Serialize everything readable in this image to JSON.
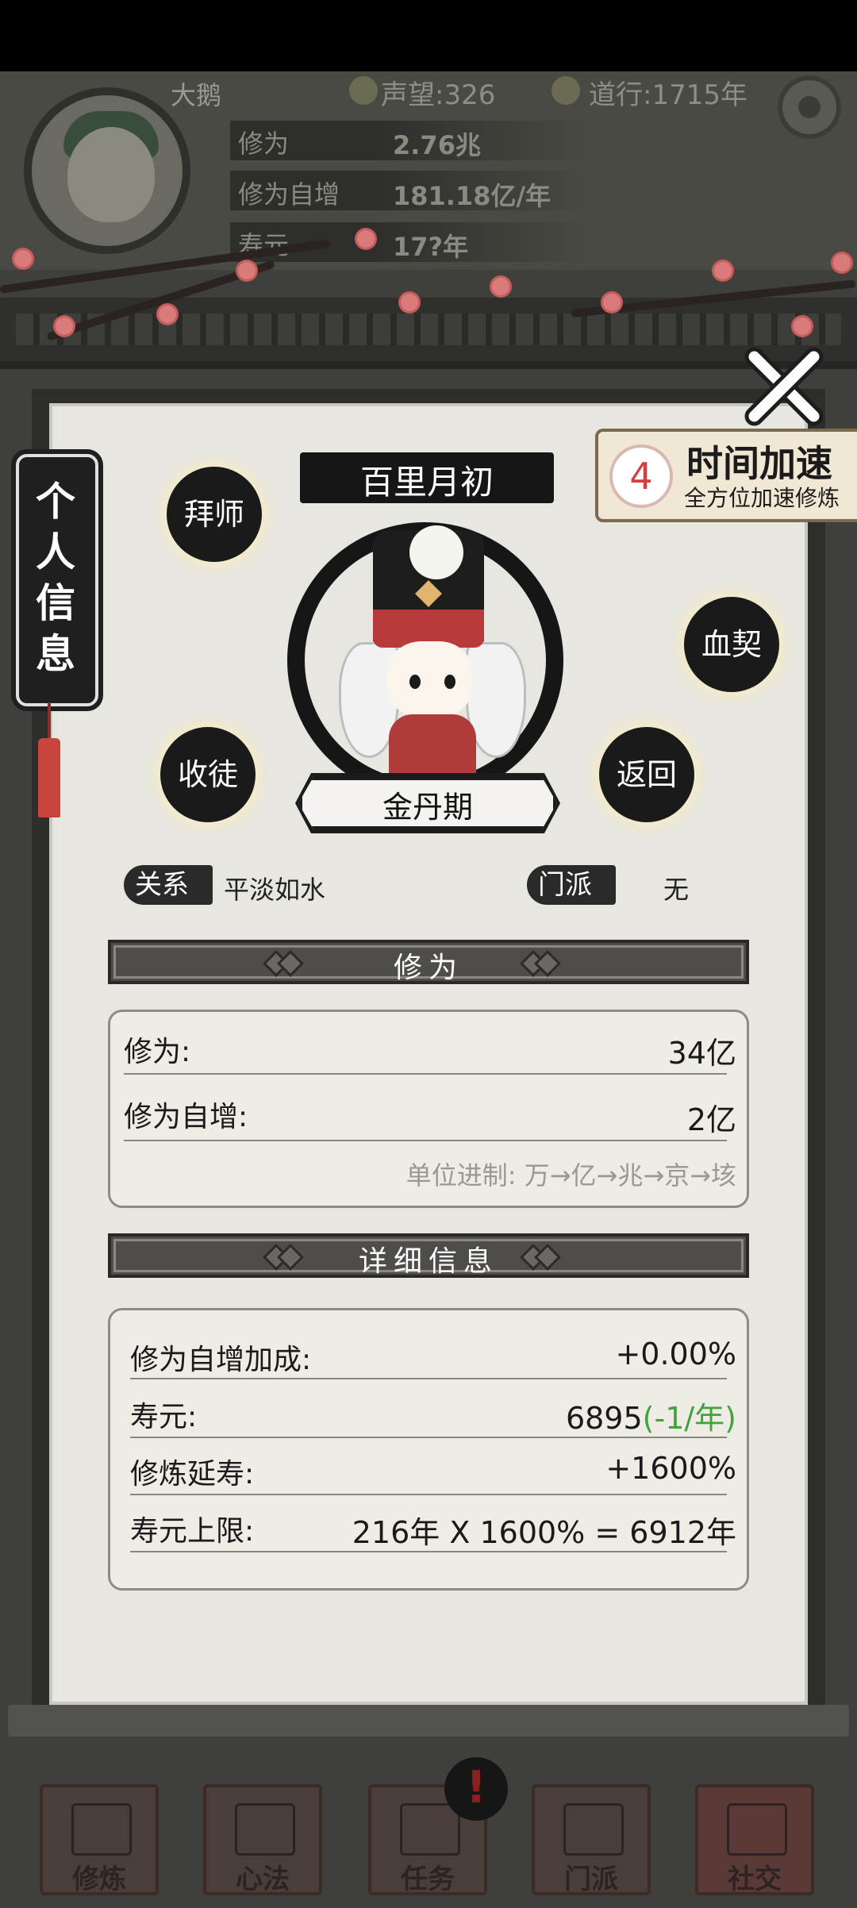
{
  "header": {
    "player_name": "大鹅",
    "reputation": "声望:326",
    "daoxing": "道行:1715年",
    "rows": [
      {
        "label": "修为",
        "value": "2.76兆"
      },
      {
        "label": "修为自增",
        "value": "181.18亿/年"
      },
      {
        "label": "寿元",
        "value": "17?年"
      }
    ]
  },
  "side_tab": {
    "label": "个人信息"
  },
  "accelerate": {
    "badge": "4",
    "title": "时间加速",
    "subtitle": "全方位加速修炼"
  },
  "profile": {
    "name": "百里月初",
    "realm": "金丹期",
    "buttons": {
      "apprentice_master": "拜师",
      "blood_pact": "血契",
      "take_disciple": "收徒",
      "back": "返回"
    },
    "relation_label": "关系",
    "relation_value": "平淡如水",
    "sect_label": "门派",
    "sect_value": "无"
  },
  "cultivation": {
    "section_title": "修为",
    "rows": [
      {
        "label": "修为:",
        "value": "34亿"
      },
      {
        "label": "修为自增:",
        "value": "2亿"
      }
    ],
    "unit_note": "单位进制: 万→亿→兆→京→垓"
  },
  "details": {
    "section_title": "详细信息",
    "rows": [
      {
        "label": "修为自增加成:",
        "value": "+0.00%"
      },
      {
        "label": "寿元:",
        "value": "6895",
        "extra": "(-1/年)"
      },
      {
        "label": "修炼延寿:",
        "value": "+1600%"
      },
      {
        "label": "寿元上限:",
        "value": "216年 X 1600% = 6912年"
      }
    ]
  },
  "nav": [
    {
      "label": "修炼"
    },
    {
      "label": "心法"
    },
    {
      "label": "任务"
    },
    {
      "label": "门派"
    },
    {
      "label": "社交"
    }
  ],
  "colors": {
    "accent_red": "#d33f3f",
    "green_text": "#3fa43b",
    "ink": "#161616"
  }
}
